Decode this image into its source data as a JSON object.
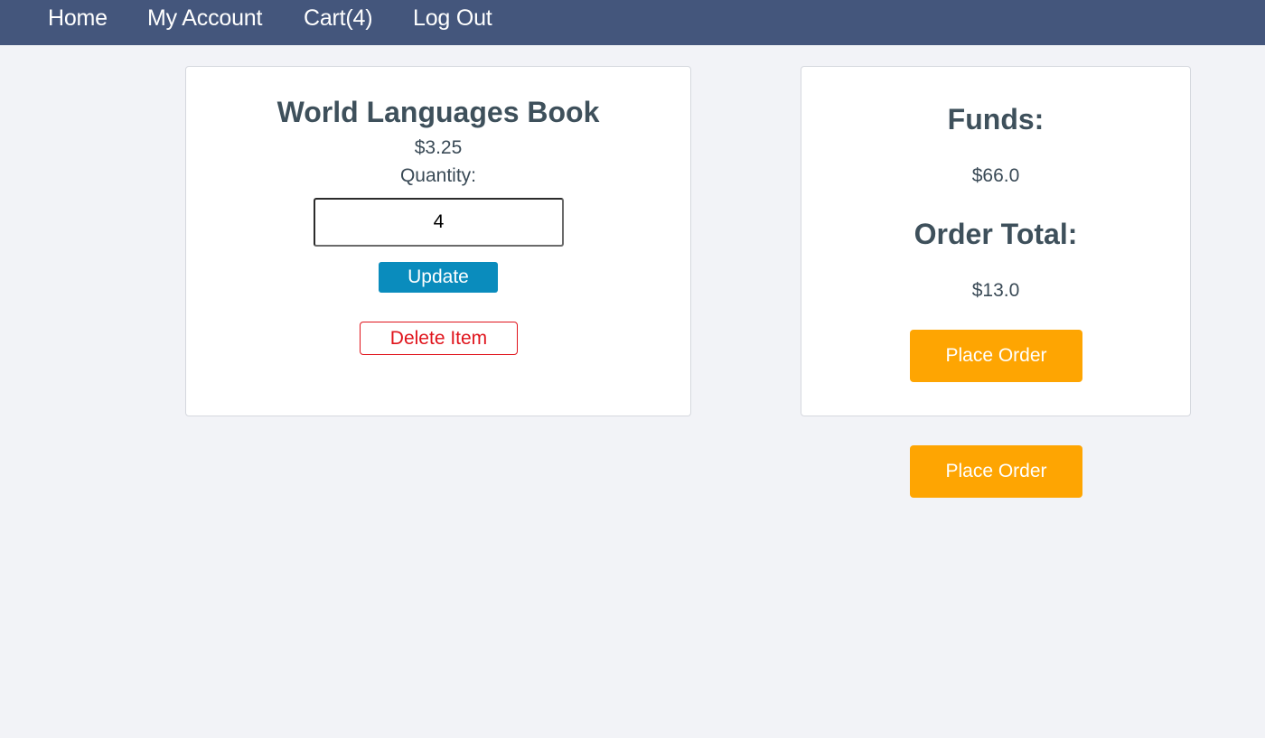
{
  "nav": {
    "home": "Home",
    "account": "My Account",
    "cart": "Cart(4)",
    "logout": "Log Out"
  },
  "item": {
    "title": "World Languages Book",
    "price": "$3.25",
    "quantity_label": "Quantity:",
    "quantity_value": "4",
    "update_label": "Update",
    "delete_label": "Delete Item"
  },
  "summary": {
    "funds_heading": "Funds:",
    "funds_value": "$66.0",
    "total_heading": "Order Total:",
    "total_value": "$13.0",
    "place_order_label": "Place Order"
  },
  "footer": {
    "place_order_label": "Place Order"
  },
  "colors": {
    "navbar": "#44567c",
    "update_button": "#0a8cbd",
    "delete_accent": "#e0141c",
    "place_order": "#fea502",
    "page_background": "#f2f3f7"
  }
}
